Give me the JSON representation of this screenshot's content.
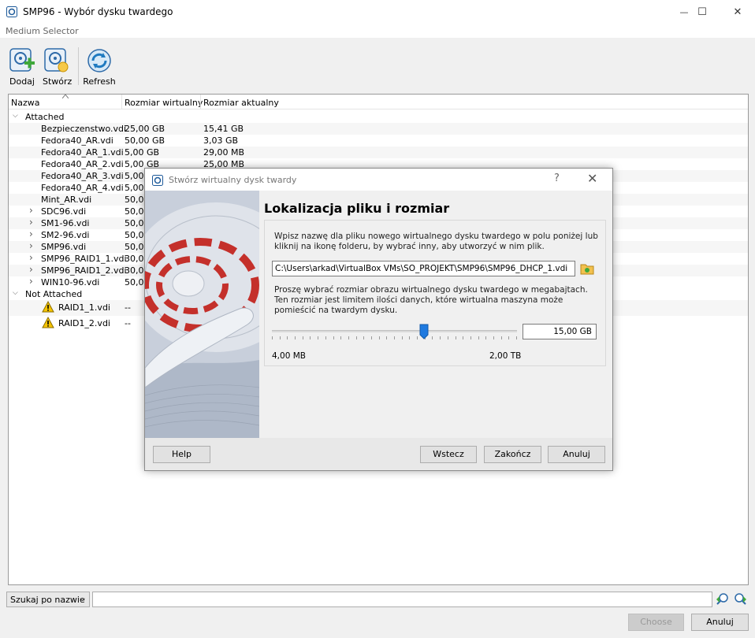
{
  "window": {
    "title": "SMP96 - Wybór dysku twardego",
    "minimize": "—",
    "maximize": "☐",
    "close": "✕"
  },
  "menu": {
    "label": "Medium Selector"
  },
  "toolbar": {
    "add": "Dodaj",
    "create": "Stwórz",
    "refresh": "Refresh"
  },
  "table": {
    "columns": [
      "Nazwa",
      "Rozmiar wirtualny",
      "Rozmiar aktualny"
    ],
    "attached_label": "Attached",
    "not_attached_label": "Not Attached",
    "attached": [
      {
        "name": "Bezpieczenstwo.vdi",
        "virtual": "25,00 GB",
        "actual": "15,41 GB",
        "expandable": false
      },
      {
        "name": "Fedora40_AR.vdi",
        "virtual": "50,00 GB",
        "actual": "3,03 GB",
        "expandable": false
      },
      {
        "name": "Fedora40_AR_1.vdi",
        "virtual": "5,00 GB",
        "actual": "29,00 MB",
        "expandable": false
      },
      {
        "name": "Fedora40_AR_2.vdi",
        "virtual": "5,00 GB",
        "actual": "25,00 MB",
        "expandable": false
      },
      {
        "name": "Fedora40_AR_3.vdi",
        "virtual": "5,00 GB",
        "actual": "",
        "expandable": false
      },
      {
        "name": "Fedora40_AR_4.vdi",
        "virtual": "5,00",
        "actual": "",
        "expandable": false
      },
      {
        "name": "Mint_AR.vdi",
        "virtual": "50,00",
        "actual": "",
        "expandable": false
      },
      {
        "name": "SDC96.vdi",
        "virtual": "50,00",
        "actual": "",
        "expandable": true
      },
      {
        "name": "SM1-96.vdi",
        "virtual": "50,00",
        "actual": "",
        "expandable": true
      },
      {
        "name": "SM2-96.vdi",
        "virtual": "50,00",
        "actual": "",
        "expandable": true
      },
      {
        "name": "SMP96.vdi",
        "virtual": "50,00",
        "actual": "",
        "expandable": true
      },
      {
        "name": "SMP96_RAID1_1.vdi",
        "virtual": "30,00",
        "actual": "",
        "expandable": true
      },
      {
        "name": "SMP96_RAID1_2.vdi",
        "virtual": "30,00",
        "actual": "",
        "expandable": true
      },
      {
        "name": "WIN10-96.vdi",
        "virtual": "50,00",
        "actual": "",
        "expandable": true
      }
    ],
    "not_attached": [
      {
        "name": "RAID1_1.vdi",
        "virtual": "--"
      },
      {
        "name": "RAID1_2.vdi",
        "virtual": "--"
      }
    ]
  },
  "search": {
    "mode": "Szukaj po nazwie",
    "value": ""
  },
  "buttons": {
    "choose": "Choose",
    "cancel": "Anuluj"
  },
  "dialog": {
    "title": "Stwórz wirtualny dysk twardy",
    "help_glyph": "?",
    "heading": "Lokalizacja pliku i rozmiar",
    "location_text": "Wpisz nazwę dla pliku nowego wirtualnego dysku twardego w polu poniżej lub kliknij na ikonę folderu, by wybrać inny, aby utworzyć w nim plik.",
    "path": "C:\\Users\\arkad\\VirtualBox VMs\\SO_PROJEKT\\SMP96\\SMP96_DHCP_1.vdi",
    "size_text": "Proszę wybrać rozmiar obrazu wirtualnego dysku twardego w megabajtach. Ten rozmiar jest limitem ilości danych, które wirtualna maszyna może pomieścić na twardym dysku.",
    "size_value": "15,00 GB",
    "slider_fraction": 0.62,
    "min_label": "4,00 MB",
    "max_label": "2,00 TB",
    "buttons": {
      "help": "Help",
      "back": "Wstecz",
      "finish": "Zakończ",
      "cancel": "Anuluj"
    }
  }
}
